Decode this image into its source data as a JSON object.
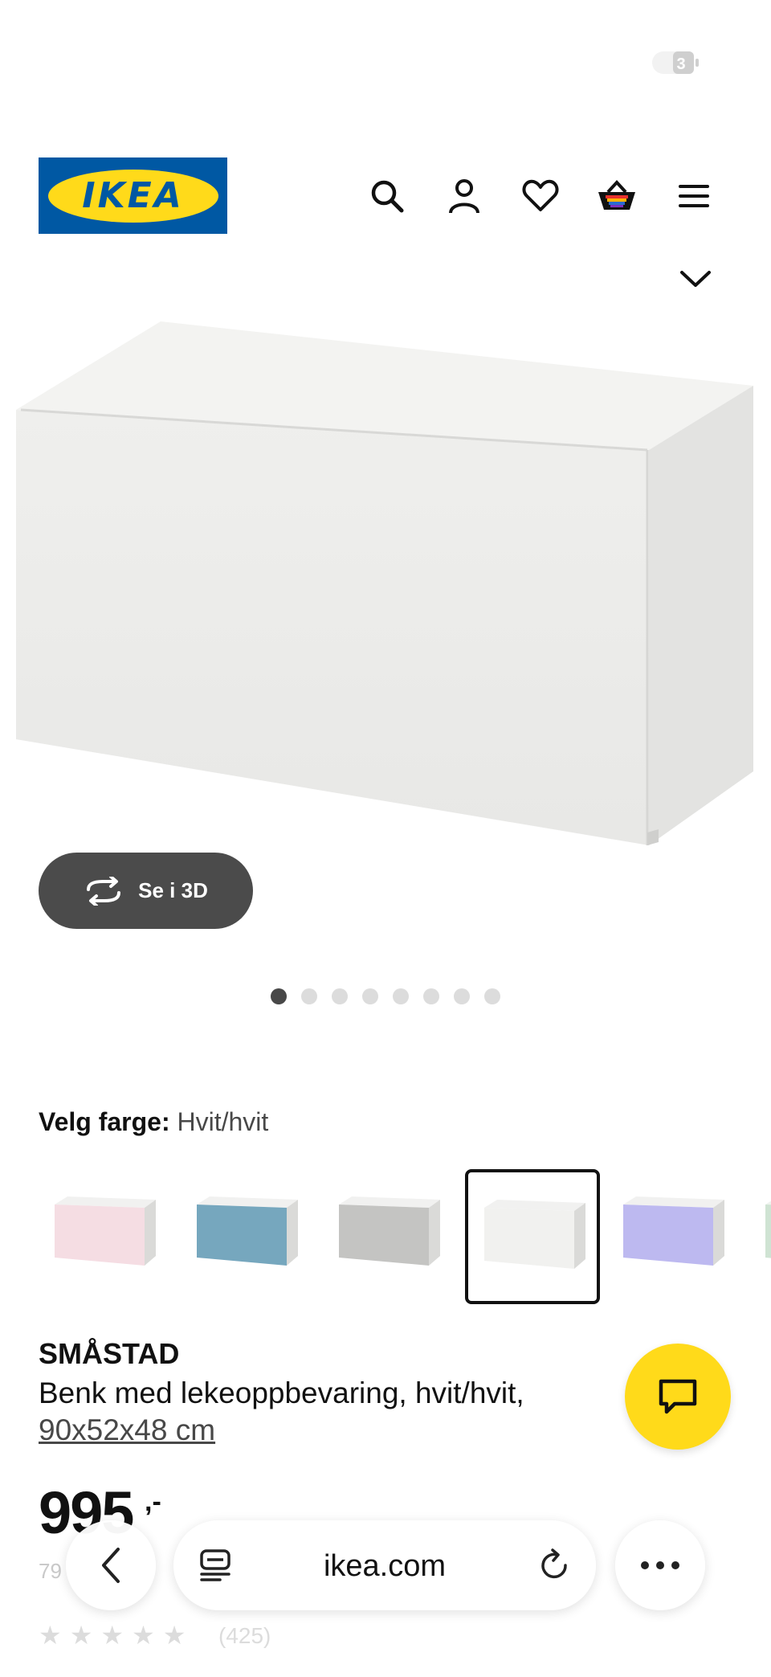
{
  "status_bar": {
    "battery_level": "3"
  },
  "header": {
    "logo_text": "IKEA",
    "icons": [
      "search-icon",
      "account-icon",
      "heart-icon",
      "shopping-bag-icon",
      "menu-icon"
    ]
  },
  "gallery": {
    "view_3d_label": "Se i 3D",
    "image_count": 8,
    "active_index": 0
  },
  "color_choice": {
    "label": "Velg farge:",
    "value": "Hvit/hvit",
    "swatches": [
      {
        "name": "rosa",
        "front": "#f5dde3"
      },
      {
        "name": "blå",
        "front": "#76a7be"
      },
      {
        "name": "grå",
        "front": "#c4c4c2"
      },
      {
        "name": "hvit",
        "front": "#f1f1ef",
        "selected": true
      },
      {
        "name": "lilla",
        "front": "#bdb9f0"
      }
    ]
  },
  "product": {
    "name": "SMÅSTAD",
    "description": "Benk med lekeoppbevaring, hvit/hvit,",
    "dimensions": "90x52x48 cm",
    "price": "995",
    "price_suffix": ",-",
    "faded_line": "79",
    "review_count": "(425)"
  },
  "browser": {
    "url": "ikea.com"
  },
  "colors": {
    "ikea_blue": "#0058a3",
    "ikea_yellow": "#ffda1a",
    "dark_button": "#4b4b4b"
  }
}
